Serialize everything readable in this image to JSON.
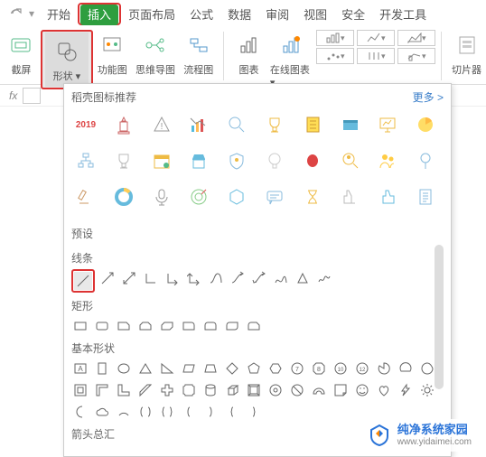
{
  "tabs": {
    "start": "开始",
    "insert": "插入",
    "page_layout": "页面布局",
    "formula": "公式",
    "data": "数据",
    "review": "审阅",
    "view": "视图",
    "security": "安全",
    "dev": "开发工具"
  },
  "ribbon": {
    "screenshot": "截屏",
    "shape": "形状",
    "func_chart": "功能图",
    "mindmap": "思维导图",
    "flowchart": "流程图",
    "chart": "图表",
    "online_chart": "在线图表",
    "slicer": "切片器"
  },
  "fx_label": "fx",
  "dropdown": {
    "title": "稻壳图标推荐",
    "more": "更多 >",
    "preset": "预设",
    "lines": "线条",
    "rect": "矩形",
    "basic": "基本形状",
    "arrows": "箭头总汇",
    "year": "2019"
  },
  "watermark": {
    "line1": "纯净系统家园",
    "line2": "www.yidaimei.com"
  }
}
